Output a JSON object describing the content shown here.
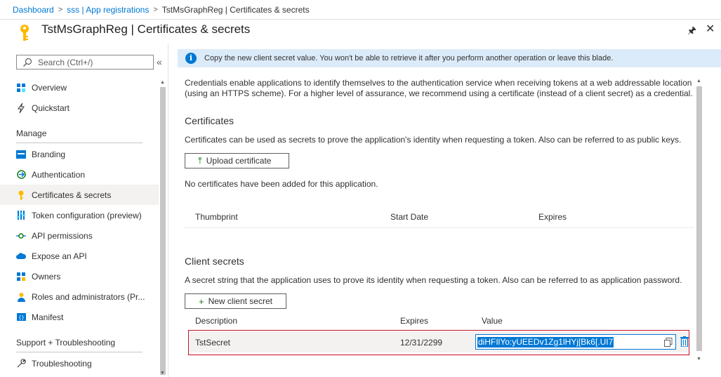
{
  "breadcrumb": {
    "items": [
      "Dashboard",
      "sss | App registrations"
    ],
    "current": "TstMsGraphReg | Certificates & secrets"
  },
  "title": "TstMsGraphReg | Certificates & secrets",
  "header_icons": {
    "pin": "pin-icon",
    "close": "close-icon"
  },
  "left_menu": {
    "search_placeholder": "Search (Ctrl+/)",
    "collapse": "«",
    "top_items": [
      {
        "label": "Overview",
        "icon": "overview-icon"
      },
      {
        "label": "Quickstart",
        "icon": "quickstart-icon"
      }
    ],
    "manage_heading": "Manage",
    "manage_items": [
      {
        "label": "Branding",
        "icon": "branding-icon"
      },
      {
        "label": "Authentication",
        "icon": "authentication-icon"
      },
      {
        "label": "Certificates & secrets",
        "icon": "key-icon",
        "selected": true
      },
      {
        "label": "Token configuration (preview)",
        "icon": "token-icon"
      },
      {
        "label": "API permissions",
        "icon": "api-permissions-icon"
      },
      {
        "label": "Expose an API",
        "icon": "cloud-icon"
      },
      {
        "label": "Owners",
        "icon": "owners-icon"
      },
      {
        "label": "Roles and administrators (Pr...",
        "icon": "roles-icon"
      },
      {
        "label": "Manifest",
        "icon": "manifest-icon"
      }
    ],
    "support_heading": "Support + Troubleshooting",
    "support_items": [
      {
        "label": "Troubleshooting",
        "icon": "wrench-icon"
      }
    ]
  },
  "banner": {
    "message": "Copy the new client secret value. You won't be able to retrieve it after you perform another operation or leave this blade."
  },
  "intro": {
    "line1": "Credentials enable applications to identify themselves to the authentication service when receiving tokens at a web addressable location",
    "line2": "(using an HTTPS scheme). For a higher level of assurance, we recommend using a certificate (instead of a client secret) as a credential."
  },
  "certificates": {
    "heading": "Certificates",
    "description": "Certificates can be used as secrets to prove the application's identity when requesting a token. Also can be referred to as public keys.",
    "upload_label": "Upload certificate",
    "empty_message": "No certificates have been added for this application.",
    "columns": [
      "Thumbprint",
      "Start Date",
      "Expires"
    ]
  },
  "client_secrets": {
    "heading": "Client secrets",
    "description": "A secret string that the application uses to prove its identity when requesting a token. Also can be referred to as application password.",
    "new_label": "New client secret",
    "columns": [
      "Description",
      "Expires",
      "Value"
    ],
    "rows": [
      {
        "description": "TstSecret",
        "expires": "12/31/2299",
        "value": "diHFIlYo:yUEEDv1Zg1lHYj[Bk6[.UI7"
      }
    ]
  },
  "colors": {
    "accent": "#0078d4",
    "banner_bg": "#dcebf9",
    "highlight_border": "#c50f1f",
    "key_yellow": "#ffb900"
  }
}
